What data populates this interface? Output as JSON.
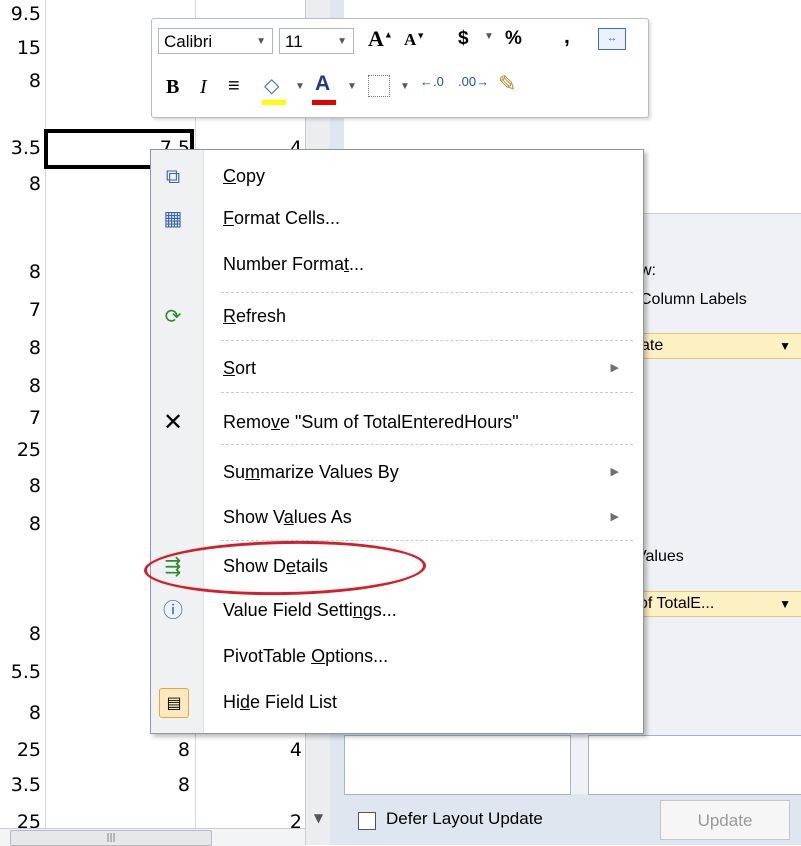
{
  "sheet": {
    "colA": [
      "9.5",
      "15",
      "8",
      "3.5",
      "8",
      "",
      "8",
      "7",
      "8",
      "8",
      "7",
      "25",
      "8",
      "8",
      "",
      "8",
      "5.5",
      "8",
      "25",
      "3.5",
      "25"
    ],
    "colB": {
      "row3_value": "7.5",
      "row18_value": "8",
      "row19_value": "8"
    },
    "colC": {
      "row3_value": "4",
      "row18_value": "4",
      "row20_value": "2"
    }
  },
  "mini_toolbar": {
    "font_name": "Calibri",
    "font_size": "11",
    "grow_font": "A",
    "shrink_font": "A",
    "currency": "$",
    "percent": "%",
    "comma": ",",
    "bold": "B",
    "italic": "I",
    "font_color": "A"
  },
  "context_menu": {
    "items": [
      {
        "label": "Copy",
        "accel": "C",
        "icon": "copy-icon"
      },
      {
        "label": "Format Cells...",
        "accel": "F",
        "icon": "format-cells-icon"
      },
      {
        "label": "Number Format...",
        "accel": "t",
        "icon": ""
      },
      {
        "label": "Refresh",
        "accel": "R",
        "icon": "refresh-icon"
      },
      {
        "label": "Sort",
        "accel": "S",
        "icon": "",
        "submenu": true
      },
      {
        "label": "Remove \"Sum of TotalEnteredHours\"",
        "accel": "v",
        "icon": "remove-icon"
      },
      {
        "label": "Summarize Values By",
        "accel": "m",
        "icon": "",
        "submenu": true
      },
      {
        "label": "Show Values As",
        "accel": "a",
        "icon": "",
        "submenu": true
      },
      {
        "label": "Show Details",
        "accel": "e",
        "icon": "show-details-icon"
      },
      {
        "label": "Value Field Settings...",
        "accel": "n",
        "icon": "value-field-settings-icon"
      },
      {
        "label": "PivotTable Options...",
        "accel": "O",
        "icon": ""
      },
      {
        "label": "Hide Field List",
        "accel": "d",
        "icon": "field-list-icon"
      }
    ]
  },
  "pivot_panel": {
    "row_area_label": "w:",
    "column_labels_title": "Column Labels",
    "column_field": "ate",
    "values_title": "Values",
    "values_field": "of TotalE...",
    "defer_label": "Defer Layout Update",
    "update_label": "Update"
  },
  "colors": {
    "highlight": "#d1202a",
    "pill": "#fdf0c2"
  }
}
